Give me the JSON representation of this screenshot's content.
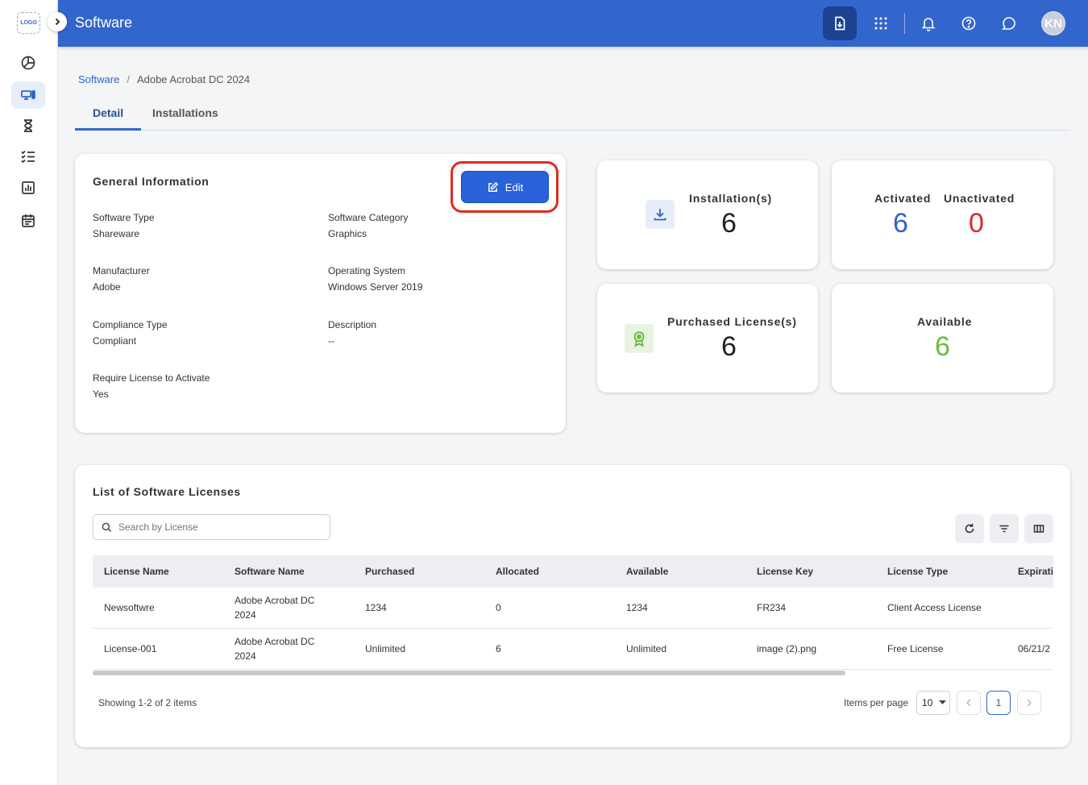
{
  "logo": {
    "text": "LOGO"
  },
  "header": {
    "title": "Software",
    "avatar_initials": "KN"
  },
  "breadcrumb": {
    "root": "Software",
    "separator": "/",
    "current": "Adobe Acrobat DC 2024"
  },
  "tabs": [
    {
      "label": "Detail"
    },
    {
      "label": "Installations"
    }
  ],
  "general": {
    "title": "General Information",
    "edit_label": "Edit",
    "fields": {
      "software_type": {
        "label": "Software Type",
        "value": "Shareware"
      },
      "software_category": {
        "label": "Software Category",
        "value": "Graphics"
      },
      "manufacturer": {
        "label": "Manufacturer",
        "value": "Adobe"
      },
      "operating_system": {
        "label": "Operating System",
        "value": "Windows Server 2019"
      },
      "compliance_type": {
        "label": "Compliance Type",
        "value": "Compliant"
      },
      "description": {
        "label": "Description",
        "value": "--"
      },
      "require_license": {
        "label": "Require License to Activate",
        "value": "Yes"
      }
    }
  },
  "stats": {
    "installations": {
      "label": "Installation(s)",
      "value": "6"
    },
    "activated": {
      "label": "Activated",
      "value": "6"
    },
    "unactivated": {
      "label": "Unactivated",
      "value": "0"
    },
    "purchased": {
      "label": "Purchased License(s)",
      "value": "6"
    },
    "available": {
      "label": "Available",
      "value": "6"
    }
  },
  "colors": {
    "accent": "#3366cc",
    "activated": "#2f64c8",
    "unactivated": "#d62b2b",
    "available": "#6dbb3c",
    "highlight": "#e02b1f"
  },
  "licenses": {
    "title": "List of Software Licenses",
    "search_placeholder": "Search by License",
    "columns": [
      "License Name",
      "Software Name",
      "Purchased",
      "Allocated",
      "Available",
      "License Key",
      "License Type",
      "Expirati"
    ],
    "rows": [
      {
        "name": "Newsoftwre",
        "software_l1": "Adobe Acrobat DC",
        "software_l2": "2024",
        "purchased": "1234",
        "allocated": "0",
        "available": "1234",
        "key": "FR234",
        "type": "Client Access License",
        "expiration": ""
      },
      {
        "name": "License-001",
        "software_l1": "Adobe Acrobat DC",
        "software_l2": "2024",
        "purchased": "Unlimited",
        "allocated": "6",
        "available": "Unlimited",
        "key": "image (2).png",
        "type": "Free License",
        "expiration": "06/21/2"
      }
    ],
    "showing": "Showing 1-2 of 2 items",
    "items_per_page_label": "Items per page",
    "items_per_page": "10",
    "current_page": "1"
  }
}
